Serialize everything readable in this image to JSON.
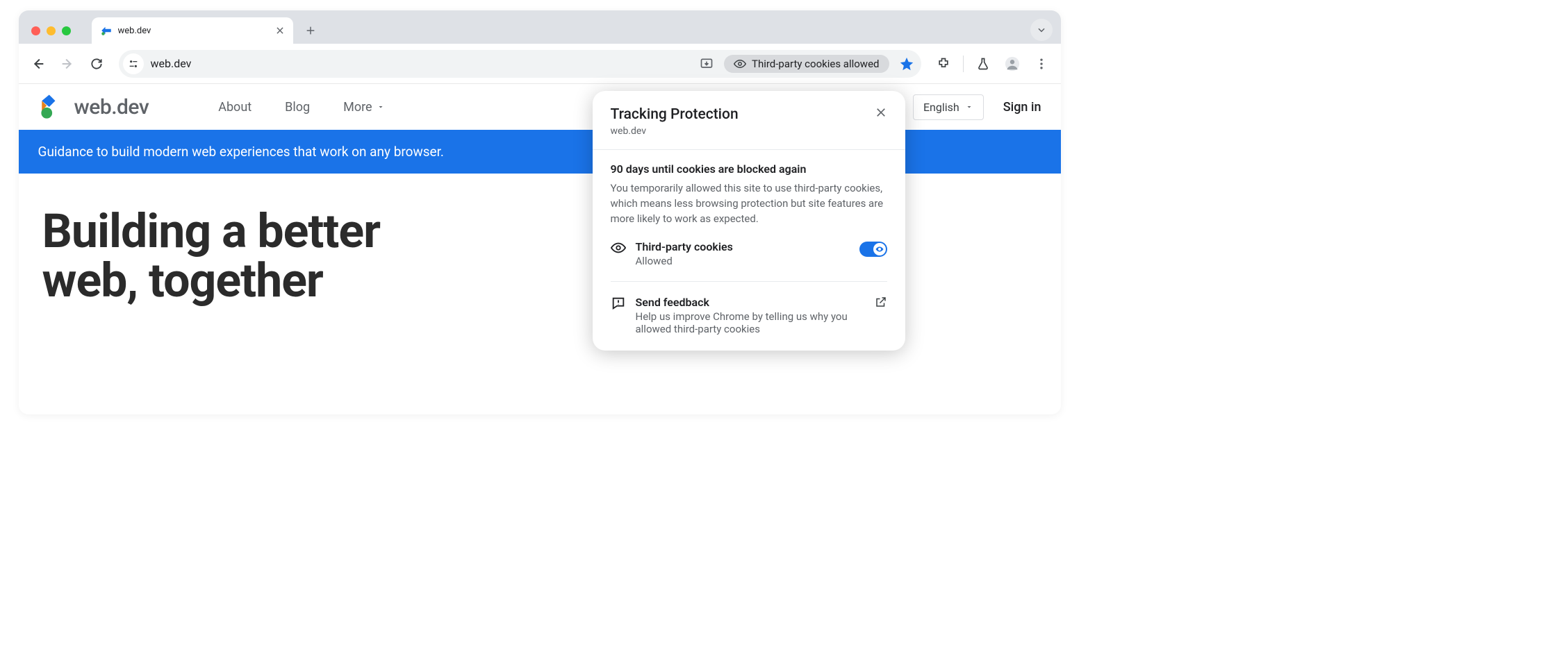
{
  "browser": {
    "tab": {
      "title": "web.dev"
    },
    "omnibox": {
      "url": "web.dev"
    },
    "chip": {
      "label": "Third-party cookies allowed"
    }
  },
  "site": {
    "logo_text": "web.dev",
    "nav": {
      "about": "About",
      "blog": "Blog",
      "more": "More"
    },
    "language": "English",
    "signin": "Sign in",
    "banner": "Guidance to build modern web experiences that work on any browser.",
    "hero_line1": "Building a better",
    "hero_line2": "web, together"
  },
  "popover": {
    "title": "Tracking Protection",
    "domain": "web.dev",
    "days_title": "90 days until cookies are blocked again",
    "days_body": "You temporarily allowed this site to use third-party cookies, which means less browsing protection but site features are more likely to work as expected.",
    "cookies_label": "Third-party cookies",
    "cookies_status": "Allowed",
    "feedback_label": "Send feedback",
    "feedback_body": "Help us improve Chrome by telling us why you allowed third-party cookies"
  }
}
